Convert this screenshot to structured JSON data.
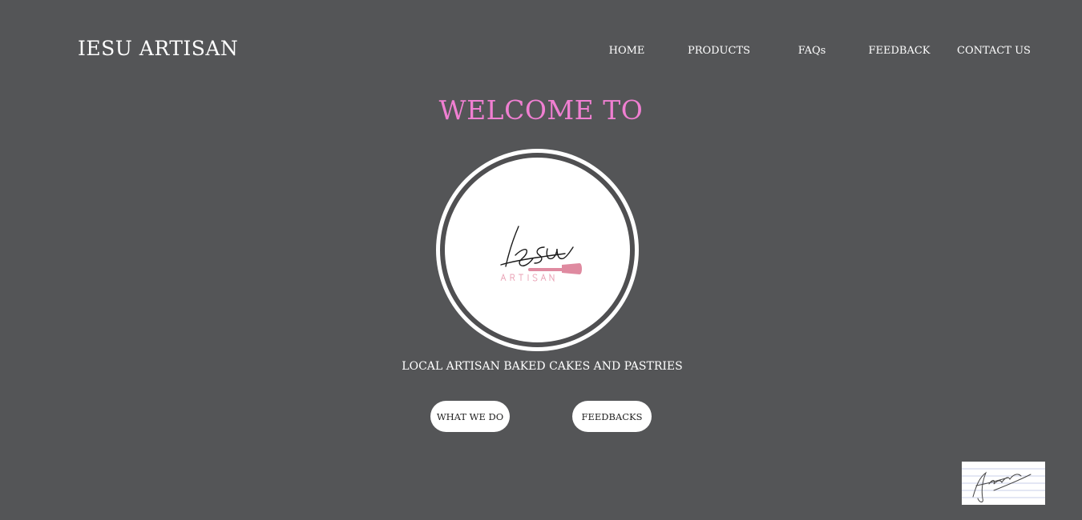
{
  "header": {
    "brand": "IESU ARTISAN",
    "nav": [
      {
        "label": "HOME"
      },
      {
        "label": "PRODUCTS"
      },
      {
        "label": "FAQs"
      },
      {
        "label": "FEEDBACK"
      },
      {
        "label": "CONTACT US"
      }
    ]
  },
  "hero": {
    "welcome": "WELCOME TO",
    "logo": {
      "script_text": "Iesu",
      "sub_text": "ARTISAN",
      "icon": "spatula-icon"
    },
    "tagline": "LOCAL ARTISAN BAKED CAKES AND PASTRIES",
    "buttons": [
      {
        "label": "WHAT WE DO"
      },
      {
        "label": "FEEDBACKS"
      }
    ]
  },
  "footer": {
    "signature_icon": "signature-image"
  },
  "colors": {
    "background": "#545557",
    "accent_pink": "#f07fd2",
    "logo_pink": "#df8aa0",
    "text": "#ffffff",
    "button_bg": "#ffffff",
    "button_text": "#1f1f1f"
  }
}
